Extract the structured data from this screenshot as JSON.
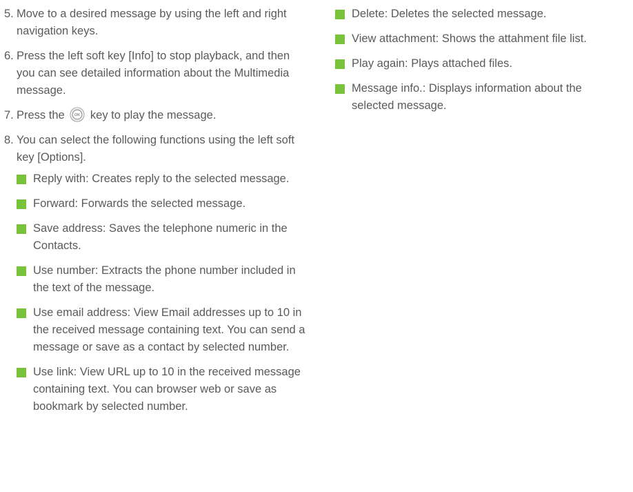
{
  "left_column": {
    "step5": {
      "num": "5.",
      "text": "Move to a desired message by using the left and right navigation keys."
    },
    "step6": {
      "num": "6.",
      "text": "Press the left soft key [Info] to stop playback, and then you can see detailed information about the Multimedia message."
    },
    "step7": {
      "num": "7.",
      "before": "Press the",
      "after": "key to play the message.",
      "icon_label": "OK",
      "icon": "ok-key-icon"
    },
    "step8": {
      "num": "8.",
      "text": "You can select the following functions using the left soft key [Options]."
    },
    "bullets": [
      "Reply with: Creates reply to the selected message.",
      "Forward: Forwards the selected message.",
      "Save address: Saves the telephone numeric in the Contacts.",
      "Use number: Extracts the phone number included in the text of the message.",
      "Use email address: View Email addresses up to 10 in the received message containing text. You can send a message or save as a contact by selected number.",
      "Use link: View URL up to 10 in the received message containing text. You can browser web or save as bookmark by selected number."
    ]
  },
  "right_column": {
    "bullets": [
      "Delete: Deletes the selected message.",
      "View attachment: Shows the attahment file list.",
      "Play again: Plays attached files.",
      "Message info.: Displays information about the selected message."
    ]
  },
  "colors": {
    "text": "#5a5a5a",
    "bullet": "#78c23c"
  }
}
